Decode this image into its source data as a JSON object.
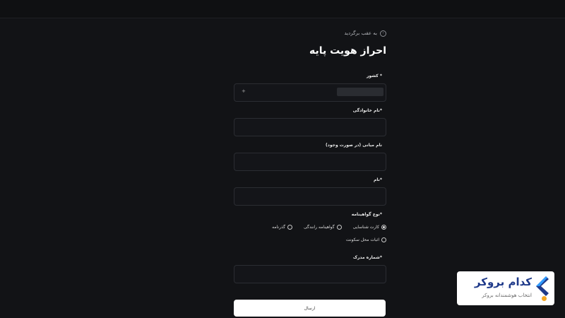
{
  "header": {
    "back_label": "به عقب برگردید",
    "title": "احراز هویت پایه"
  },
  "form": {
    "country_label": "* کشور",
    "country_select_icon": "+",
    "last_name_label": "*نام خانوادگی",
    "middle_name_label": "نام میانی (در صورت وجود)",
    "first_name_label": "*نام",
    "doc_type_label": "*نوع گواهینامه",
    "doc_options": [
      {
        "label": "کارت شناسایی",
        "selected": true
      },
      {
        "label": "گواهینامه رانندگی",
        "selected": false
      },
      {
        "label": "گذرنامه",
        "selected": false
      },
      {
        "label": "اثبات محل سکونت",
        "selected": false
      }
    ],
    "doc_number_label": "*شماره مدرک",
    "submit_label": "ارسال"
  },
  "brand": {
    "name": "کدام بروکر",
    "tagline": "انتخاب هوشمندانه بروکر",
    "colors": {
      "primary": "#1f3a8a",
      "accent": "#f5a623",
      "light": "#2f9bff"
    }
  },
  "colors": {
    "background": "#121316",
    "field_border": "#2b2d32",
    "button": "#ffffff"
  }
}
